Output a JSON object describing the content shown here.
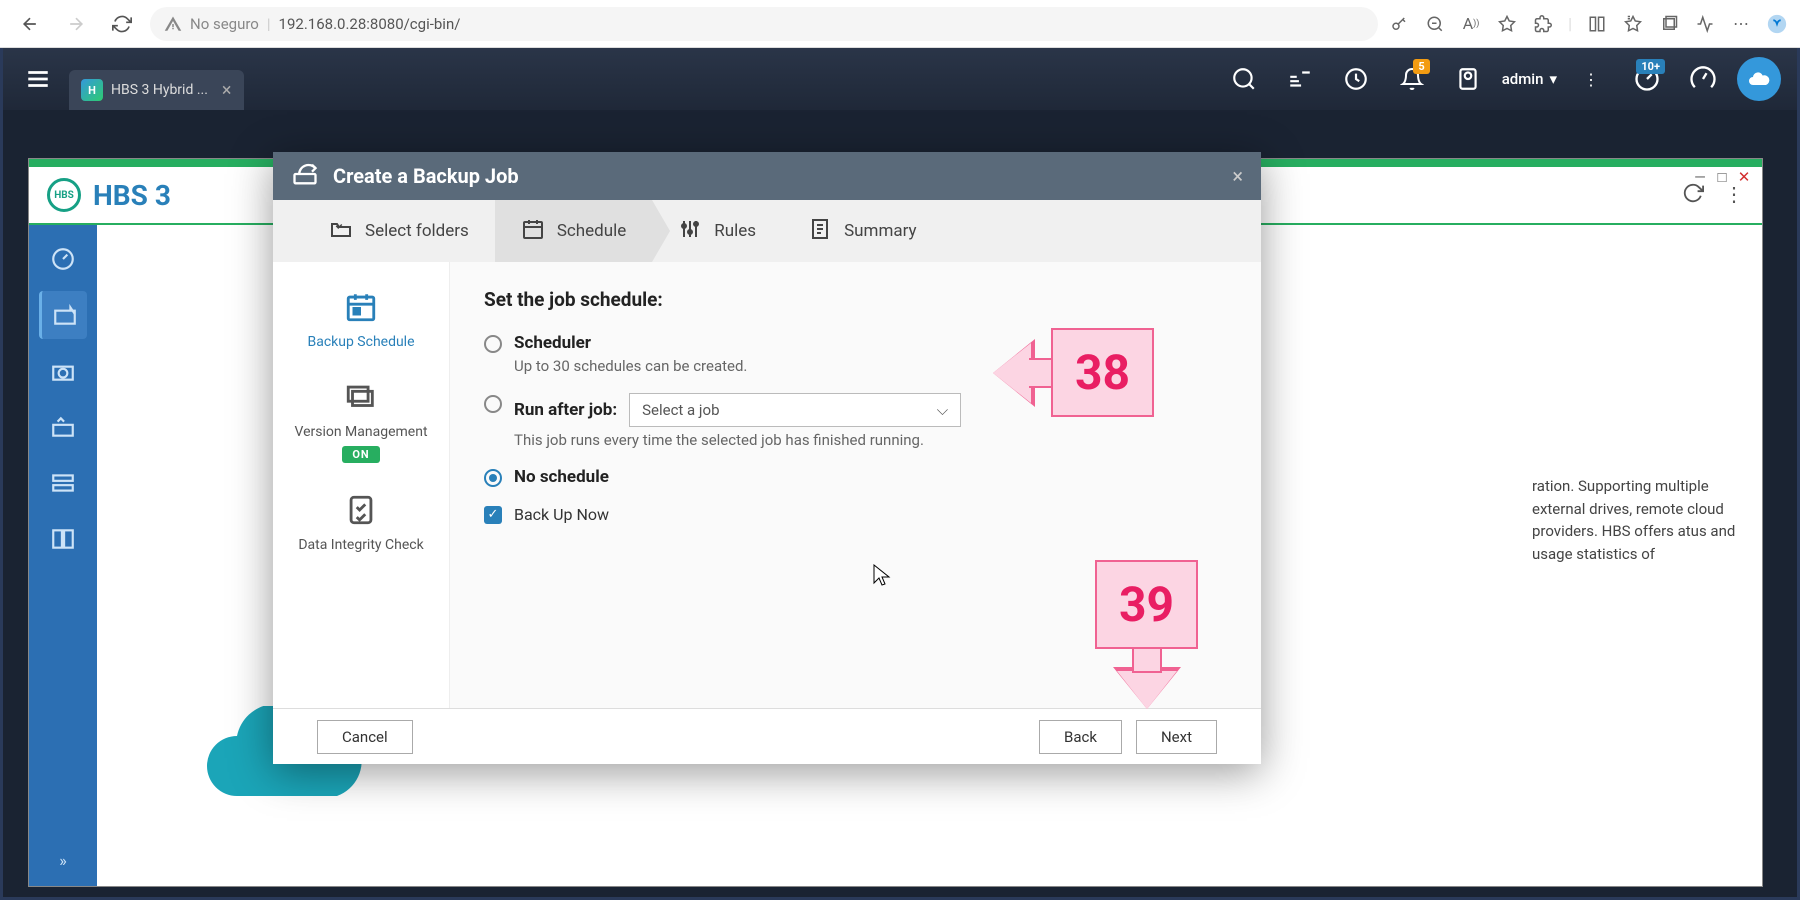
{
  "browser": {
    "security_label": "No seguro",
    "url": "192.168.0.28:8080/cgi-bin/"
  },
  "qnap_bar": {
    "tab_label": "HBS 3 Hybrid ...",
    "notif_badge": "5",
    "dashboard_badge": "10+",
    "user": "admin"
  },
  "hbs": {
    "title": "HBS 3",
    "bg_text": "ration. Supporting multiple external drives, remote cloud providers. HBS offers atus and usage statistics of"
  },
  "modal": {
    "title": "Create a Backup Job",
    "steps": {
      "select_folders": "Select folders",
      "schedule": "Schedule",
      "rules": "Rules",
      "summary": "Summary"
    },
    "sidebar": {
      "backup_schedule": "Backup Schedule",
      "version_management": "Version Management",
      "vm_badge": "ON",
      "data_integrity": "Data Integrity Check"
    },
    "content": {
      "heading": "Set the job schedule:",
      "scheduler_label": "Scheduler",
      "scheduler_desc": "Up to 30 schedules can be created.",
      "run_after_label": "Run after job:",
      "run_after_placeholder": "Select a job",
      "run_after_desc": "This job runs every time the selected job has finished running.",
      "no_schedule_label": "No schedule",
      "backup_now_label": "Back Up Now"
    },
    "footer": {
      "cancel": "Cancel",
      "back": "Back",
      "next": "Next"
    }
  },
  "annotations": {
    "a38": "38",
    "a39": "39"
  }
}
